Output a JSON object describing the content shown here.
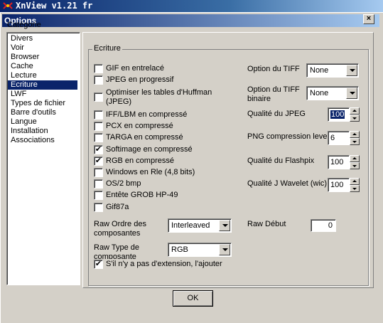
{
  "app": {
    "title": "XnView v1.21 fr"
  },
  "dialog": {
    "title": "Options",
    "close_label": "×"
  },
  "category": {
    "label": "Catégorie",
    "items": [
      "Divers",
      "Voir",
      "Browser",
      "Cache",
      "Lecture",
      "Ecriture",
      "LWF",
      "Types de fichier",
      "Barre d'outils",
      "Langue",
      "Installation",
      "Associations"
    ],
    "selected": "Ecriture"
  },
  "group": {
    "title": "Ecriture"
  },
  "checkboxes": [
    {
      "label": "GIF en entrelacé",
      "checked": false
    },
    {
      "label": "JPEG en progressif",
      "checked": false
    },
    {
      "label": "Optimiser les tables d'Huffman",
      "label2": "(JPEG)",
      "checked": false
    },
    {
      "label": "IFF/LBM en compressé",
      "checked": false
    },
    {
      "label": "PCX en compressé",
      "checked": false
    },
    {
      "label": "TARGA en compressé",
      "checked": false
    },
    {
      "label": "Softimage en compressé",
      "checked": true
    },
    {
      "label": "RGB en compressé",
      "checked": true
    },
    {
      "label": "Windows en Rle (4,8 bits)",
      "checked": false
    },
    {
      "label": "OS/2 bmp",
      "checked": false
    },
    {
      "label": "Entête GROB HP-49",
      "checked": false
    },
    {
      "label": "Gif87a",
      "checked": false
    }
  ],
  "tiff_option": {
    "label": "Option du TIFF",
    "value": "None"
  },
  "tiff_binary": {
    "label": "Option du TIFF",
    "label2": "binaire",
    "value": "None"
  },
  "jpeg_quality": {
    "label": "Qualité du JPEG",
    "value": "100"
  },
  "png_level": {
    "label": "PNG compression level",
    "value": "6"
  },
  "flashpix_quality": {
    "label": "Qualité du Flashpix",
    "value": "100"
  },
  "wavelet_quality": {
    "label": "Qualité J Wavelet (wic)",
    "value": "100"
  },
  "raw_order": {
    "label": "Raw Ordre des",
    "label2": "composantes",
    "value": "Interleaved"
  },
  "raw_type": {
    "label": "Raw Type de",
    "label2": "composante",
    "value": "RGB"
  },
  "raw_start": {
    "label": "Raw Début",
    "value": "0"
  },
  "add_extension": {
    "label": "S'il n'y a pas d'extension, l'ajouter",
    "checked": true
  },
  "ok_button": {
    "label": "OK"
  },
  "check_mark": "✔"
}
